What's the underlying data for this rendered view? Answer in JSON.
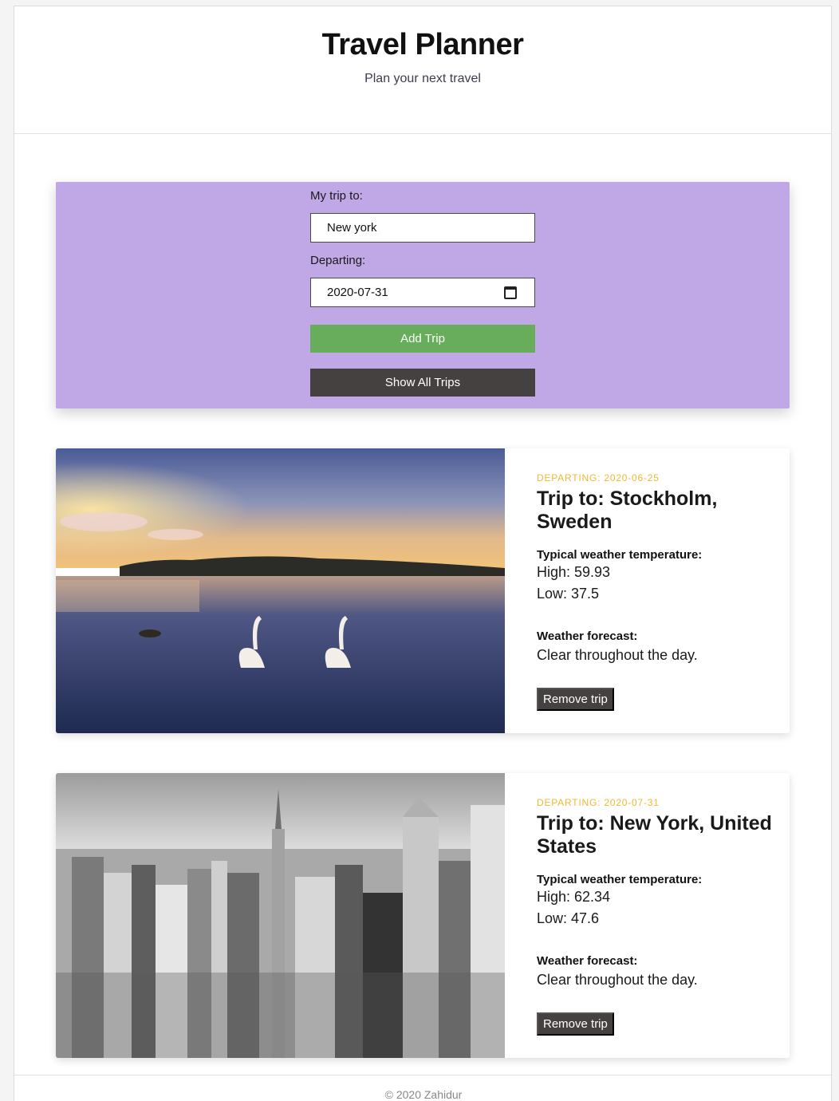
{
  "header": {
    "title": "Travel Planner",
    "subtitle": "Plan your next travel"
  },
  "form": {
    "destination_label": "My trip to:",
    "destination_value": "New york",
    "departing_label": "Departing:",
    "departing_value": "2020-07-31",
    "add_button": "Add Trip",
    "show_button": "Show All Trips"
  },
  "trips": [
    {
      "departing": "DEPARTING: 2020-06-25",
      "title": "Trip to: Stockholm, Sweden",
      "weather_label": "Typical weather temperature:",
      "high": "High: 59.93",
      "low": "Low: 37.5",
      "forecast_label": "Weather forecast:",
      "forecast": "Clear throughout the day.",
      "remove_button": "Remove trip"
    },
    {
      "departing": "DEPARTING: 2020-07-31",
      "title": "Trip to: New York, United States",
      "weather_label": "Typical weather temperature:",
      "high": "High: 62.34",
      "low": "Low: 47.6",
      "forecast_label": "Weather forecast:",
      "forecast": "Clear throughout the day.",
      "remove_button": "Remove trip"
    }
  ],
  "footer": {
    "text": "© 2020 Zahidur"
  },
  "colors": {
    "form_panel": "#c0a8e6",
    "add_button": "#67ad5b",
    "dark_button": "#464141",
    "departing_text": "#f0b830"
  },
  "icons": {
    "date_picker": "calendar-icon"
  }
}
